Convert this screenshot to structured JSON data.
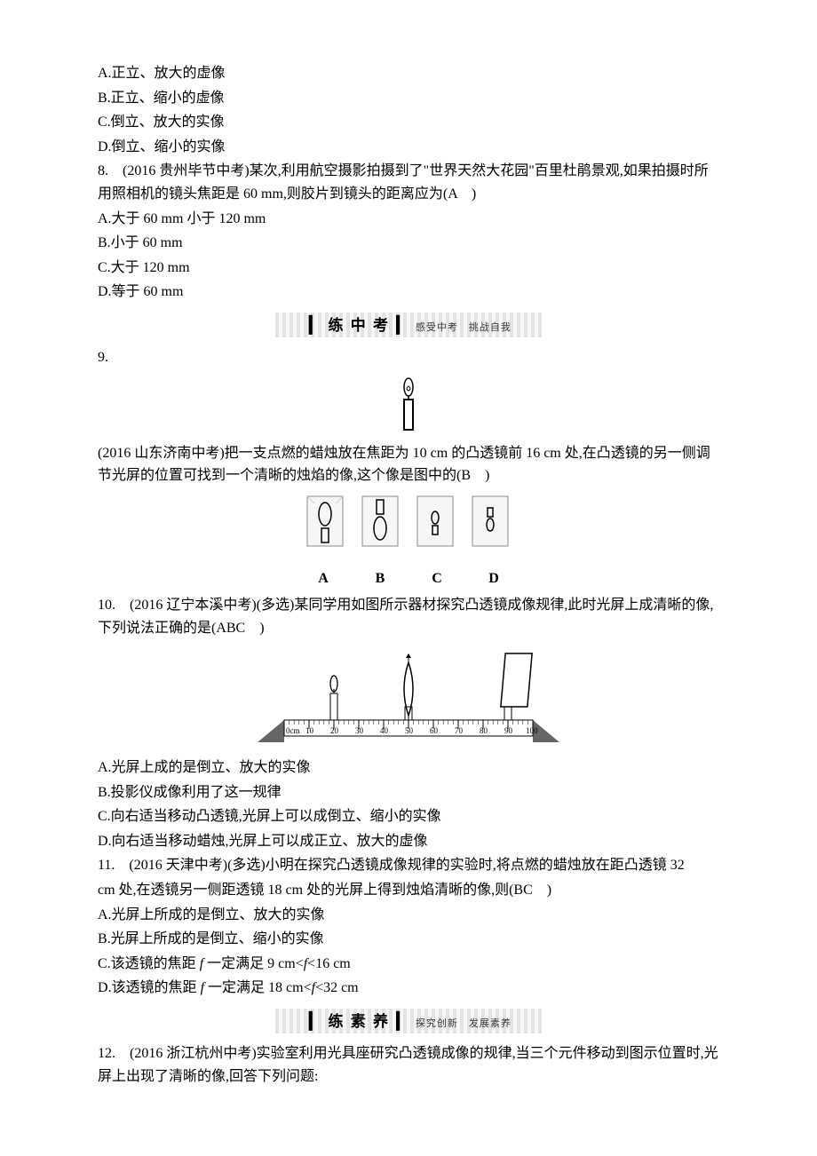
{
  "q7": {
    "optA": "A.正立、放大的虚像",
    "optB": "B.正立、缩小的虚像",
    "optC": "C.倒立、放大的实像",
    "optD": "D.倒立、缩小的实像"
  },
  "q8": {
    "stem": "8.　(2016 贵州毕节中考)某次,利用航空摄影拍摄到了\"世界天然大花园\"百里杜鹃景观,如果拍摄时所用照相机的镜头焦距是 60 mm,则胶片到镜头的距离应为(A　)",
    "optA": "A.大于 60 mm 小于 120 mm",
    "optB": "B.小于 60 mm",
    "optC": "C.大于 120 mm",
    "optD": "D.等于 60 mm"
  },
  "banner1": {
    "bar": "▎",
    "main": "练 中 考",
    "sep": "▎",
    "sub": "感受中考　挑战自我"
  },
  "q9": {
    "num": "9.",
    "stem": "(2016 山东济南中考)把一支点燃的蜡烛放在焦距为 10 cm 的凸透镜前 16 cm 处,在凸透镜的另一侧调节光屏的位置可找到一个清晰的烛焰的像,这个像是图中的(B　)",
    "labels": {
      "a": "A",
      "b": "B",
      "c": "C",
      "d": "D"
    }
  },
  "q10": {
    "stem": "10.　(2016 辽宁本溪中考)(多选)某同学用如图所示器材探究凸透镜成像规律,此时光屏上成清晰的像,下列说法正确的是(ABC　)",
    "ruler_marks": [
      "0cm",
      "10",
      "20",
      "30",
      "40",
      "50",
      "60",
      "70",
      "80",
      "90",
      "100"
    ],
    "optA": "A.光屏上成的是倒立、放大的实像",
    "optB": "B.投影仪成像利用了这一规律",
    "optC": "C.向右适当移动凸透镜,光屏上可以成倒立、缩小的实像",
    "optD": "D.向右适当移动蜡烛,光屏上可以成正立、放大的虚像"
  },
  "q11": {
    "stem_l1": "11.　(2016 天津中考)(多选)小明在探究凸透镜成像规律的实验时,将点燃的蜡烛放在距凸透镜 32",
    "stem_l2": "cm 处,在透镜另一侧距透镜 18 cm 处的光屏上得到烛焰清晰的像,则(BC　)",
    "optA": "A.光屏上所成的是倒立、放大的实像",
    "optB": "B.光屏上所成的是倒立、缩小的实像",
    "optC_pre": "C.该透镜的焦距 ",
    "optC_f": "f",
    "optC_mid": " 一定满足 9 cm<",
    "optC_f2": "f",
    "optC_post": "<16 cm",
    "optD_pre": "D.该透镜的焦距 ",
    "optD_f": "f",
    "optD_mid": " 一定满足 18 cm<",
    "optD_f2": "f",
    "optD_post": "<32 cm"
  },
  "banner2": {
    "bar": "▎",
    "main": "练 素 养",
    "sep": "▎",
    "sub": "探究创新　发展素养"
  },
  "q12": {
    "stem": "12.　(2016 浙江杭州中考)实验室利用光具座研究凸透镜成像的规律,当三个元件移动到图示位置时,光屏上出现了清晰的像,回答下列问题:"
  }
}
